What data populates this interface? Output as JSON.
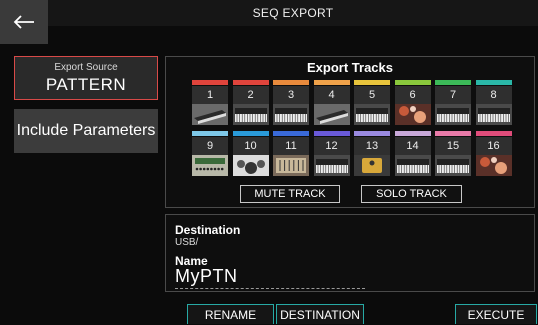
{
  "header": {
    "title": "SEQ EXPORT",
    "back_icon": "arrow-left-icon"
  },
  "left": {
    "export_source_label": "Export Source",
    "export_source_value": "PATTERN",
    "include_parameters": "Include Parameters"
  },
  "tracks": {
    "title": "Export Tracks",
    "items": [
      {
        "num": "1",
        "color": "#e0443c",
        "img": "synth"
      },
      {
        "num": "2",
        "color": "#e0443c",
        "img": "keyboard"
      },
      {
        "num": "3",
        "color": "#e88a3c",
        "img": "keyboard"
      },
      {
        "num": "4",
        "color": "#f0a24a",
        "img": "synth"
      },
      {
        "num": "5",
        "color": "#e8c43c",
        "img": "keyboard"
      },
      {
        "num": "6",
        "color": "#8ac83c",
        "img": "pattern"
      },
      {
        "num": "7",
        "color": "#3cba58",
        "img": "keyboard"
      },
      {
        "num": "8",
        "color": "#2ab8a8",
        "img": "keyboard"
      },
      {
        "num": "9",
        "color": "#7ec8e8",
        "img": "module"
      },
      {
        "num": "10",
        "color": "#2a9ad8",
        "img": "drums"
      },
      {
        "num": "11",
        "color": "#3a6ad8",
        "img": "mixer"
      },
      {
        "num": "12",
        "color": "#6a5ad8",
        "img": "keyboard"
      },
      {
        "num": "13",
        "color": "#9a8ae0",
        "img": "pedal"
      },
      {
        "num": "14",
        "color": "#c8a8d8",
        "img": "keyboard"
      },
      {
        "num": "15",
        "color": "#e87aa8",
        "img": "keyboard"
      },
      {
        "num": "16",
        "color": "#e04c7a",
        "img": "pattern"
      }
    ],
    "mute": "MUTE TRACK",
    "solo": "SOLO TRACK"
  },
  "destination": {
    "label": "Destination",
    "path": "USB/",
    "name_label": "Name",
    "name_value": "MyPTN"
  },
  "bottom": {
    "rename": "RENAME",
    "destination": "DESTINATION",
    "execute": "EXECUTE"
  }
}
